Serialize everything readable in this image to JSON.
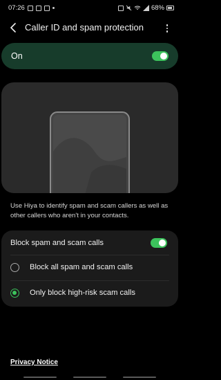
{
  "status_bar": {
    "time": "07:26",
    "battery": "68%"
  },
  "header": {
    "title": "Caller ID and spam protection"
  },
  "master_toggle": {
    "label": "On",
    "state": true
  },
  "description": "Use Hiya to identify spam and scam callers as well as other callers who aren't in your contacts.",
  "block_card": {
    "toggle_label": "Block spam and scam calls",
    "toggle_state": true,
    "options": [
      {
        "label": "Block all spam and scam calls",
        "selected": false
      },
      {
        "label": "Only block high-risk scam calls",
        "selected": true
      }
    ]
  },
  "footer": {
    "privacy_link": "Privacy Notice"
  },
  "colors": {
    "accent": "#3cc35c",
    "master_bg": "#173c2b",
    "card_bg": "#1b1b1b",
    "background": "#000000"
  },
  "icons": [
    "back-arrow-icon",
    "more-options-icon",
    "photo-icon",
    "mute-icon",
    "wifi-icon",
    "signal-icon",
    "battery-icon"
  ]
}
